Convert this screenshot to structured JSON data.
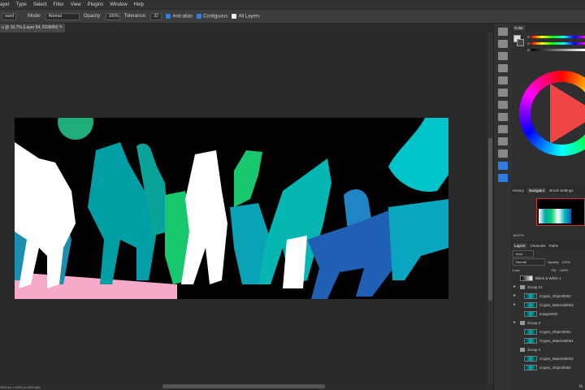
{
  "menubar": {
    "items": [
      "ayer",
      "Type",
      "Select",
      "Filter",
      "View",
      "Plugins",
      "Window",
      "Help"
    ]
  },
  "options": {
    "preset": "ound",
    "mode_label": "Mode:",
    "mode_value": "Normal",
    "opacity_label": "Opacity:",
    "opacity_value": "100%",
    "tolerance_label": "Tolerance:",
    "tolerance_value": "32",
    "antialias_label": "Anti-alias",
    "contiguous_label": "Contiguous",
    "alllayers_label": "All Layers"
  },
  "document": {
    "tab_title": "o @ 16.7% (Layer 54, RGB/8#) *",
    "close": "×"
  },
  "status": {
    "dims": "4800 px x 6000 px (300 ppi)"
  },
  "color_panel": {
    "title": "Color",
    "r": "R",
    "g": "G",
    "b": "B"
  },
  "nav_panel": {
    "tabs": [
      "History",
      "Navigator",
      "Brush Settings"
    ],
    "zoom": "16.67%"
  },
  "layers_panel": {
    "tabs": [
      "Layers",
      "Channels",
      "Paths"
    ],
    "kind": "Kind",
    "blend": "Normal",
    "opacity_label": "Opacity:",
    "opacity_value": "100%",
    "lock_label": "Lock:",
    "fill_label": "Fill:",
    "fill_value": "100%",
    "rows": [
      {
        "name": "Black & White 1",
        "type": "adjust",
        "eye": false
      },
      {
        "name": "Group 21",
        "type": "group",
        "eye": true
      },
      {
        "name": "Crypto_Object0002",
        "type": "layer",
        "eye": true
      },
      {
        "name": "Crypto_Material0002",
        "type": "layer",
        "eye": true
      },
      {
        "name": "Image0002",
        "type": "layer",
        "eye": false
      },
      {
        "name": "Group 2",
        "type": "group",
        "eye": true
      },
      {
        "name": "Crypto_Object0001",
        "type": "layer",
        "eye": false
      },
      {
        "name": "Crypto_Material0001",
        "type": "layer",
        "eye": false
      },
      {
        "name": "Group 1",
        "type": "group",
        "eye": false
      },
      {
        "name": "Crypto_Material0002",
        "type": "layer",
        "eye": false
      },
      {
        "name": "Crypto_Object0002",
        "type": "layer",
        "eye": false
      }
    ]
  },
  "bottom": {
    "fx": "fx"
  },
  "colors": {
    "pink": "#f6a9c9",
    "teal": "#00c4c9",
    "green": "#19c86e",
    "blue": "#1f5fb4",
    "white": "#ffffff"
  }
}
